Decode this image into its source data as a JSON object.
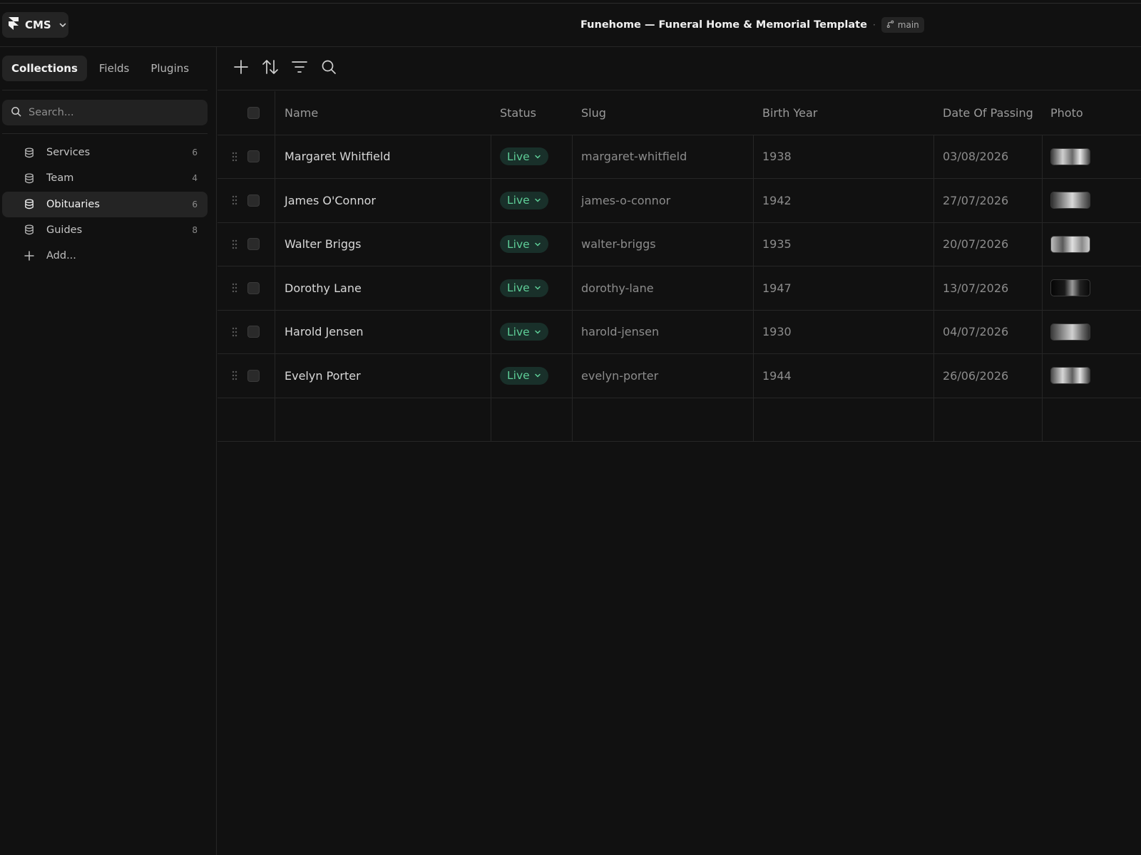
{
  "app": {
    "menu_label": "CMS",
    "project_title": "Funehome — Funeral Home & Memorial Template",
    "separator": "·",
    "branch": "main"
  },
  "sidebar": {
    "tabs": [
      {
        "label": "Collections",
        "active": true
      },
      {
        "label": "Fields",
        "active": false
      },
      {
        "label": "Plugins",
        "active": false
      }
    ],
    "search_placeholder": "Search...",
    "collections": [
      {
        "label": "Services",
        "count": "6"
      },
      {
        "label": "Team",
        "count": "4"
      },
      {
        "label": "Obituaries",
        "count": "6",
        "active": true
      },
      {
        "label": "Guides",
        "count": "8"
      }
    ],
    "add_label": "Add..."
  },
  "toolbar": {
    "icons": [
      "plus-icon",
      "sort-icon",
      "filter-icon",
      "search-icon"
    ]
  },
  "table": {
    "columns": [
      "Name",
      "Status",
      "Slug",
      "Birth Year",
      "Date Of Passing",
      "Photo"
    ],
    "rows": [
      {
        "name": "Margaret Whitfield",
        "status": "Live",
        "slug": "margaret-whitfield",
        "birth_year": "1938",
        "date_of_passing": "03/08/2026"
      },
      {
        "name": "James O'Connor",
        "status": "Live",
        "slug": "james-o-connor",
        "birth_year": "1942",
        "date_of_passing": "27/07/2026"
      },
      {
        "name": "Walter Briggs",
        "status": "Live",
        "slug": "walter-briggs",
        "birth_year": "1935",
        "date_of_passing": "20/07/2026"
      },
      {
        "name": "Dorothy Lane",
        "status": "Live",
        "slug": "dorothy-lane",
        "birth_year": "1947",
        "date_of_passing": "13/07/2026"
      },
      {
        "name": "Harold Jensen",
        "status": "Live",
        "slug": "harold-jensen",
        "birth_year": "1930",
        "date_of_passing": "04/07/2026"
      },
      {
        "name": "Evelyn Porter",
        "status": "Live",
        "slug": "evelyn-porter",
        "birth_year": "1944",
        "date_of_passing": "26/06/2026"
      }
    ]
  },
  "colors": {
    "background": "#111111",
    "panel": "#242424",
    "border": "#262626",
    "live_text": "#5fcf98",
    "live_bg": "#19302a"
  }
}
